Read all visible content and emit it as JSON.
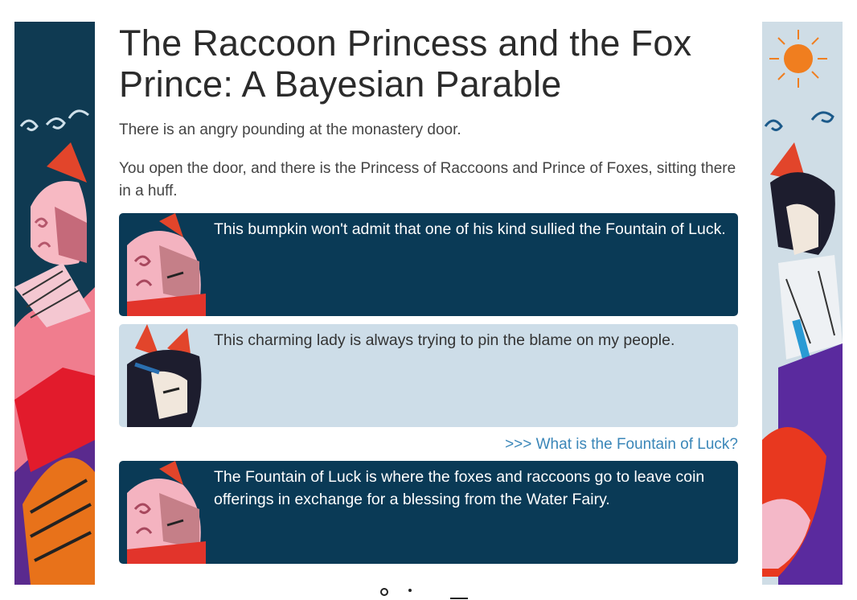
{
  "page": {
    "title": "The Raccoon Princess and the Fox Prince: A Bayesian Parable",
    "narration": [
      "There is an angry pounding at the monastery door.",
      "You open the door, and there is the Princess of Raccoons and Prince of Foxes, sitting there in a huff."
    ]
  },
  "dialogue": [
    {
      "speaker_icon": "raccoon-princess-portrait",
      "style": "dark",
      "text": "This bumpkin won't admit that one of his kind sullied the Fountain of Luck."
    },
    {
      "speaker_icon": "fox-prince-portrait",
      "style": "light",
      "text": "This charming lady is always trying to pin the blame on my people."
    },
    {
      "speaker_icon": "raccoon-princess-portrait",
      "style": "dark",
      "text": "The Fountain of Luck is where the foxes and raccoons go to leave coin offerings in exchange for a blessing from the Water Fairy."
    }
  ],
  "choice": {
    "label": ">>> What is the Fountain of Luck?"
  },
  "colors": {
    "dark_bubble": "#0a3a56",
    "light_bubble": "#cddde8",
    "link": "#3a86b8"
  }
}
